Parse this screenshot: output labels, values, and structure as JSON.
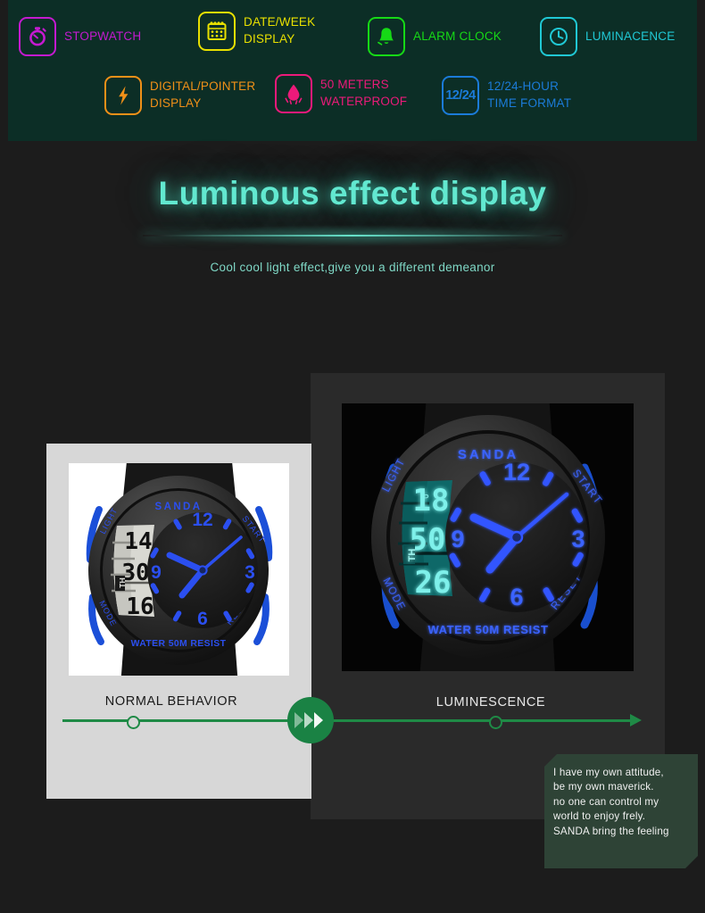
{
  "features": [
    {
      "id": "stopwatch",
      "icon": "stopwatch-icon",
      "label": "STOPWATCH",
      "color": "#c41ad0"
    },
    {
      "id": "date-week",
      "icon": "calendar-icon",
      "label": "DATE/WEEK\nDISPLAY",
      "color": "#e8e000"
    },
    {
      "id": "alarm-clock",
      "icon": "bell-icon",
      "label": "ALARM CLOCK",
      "color": "#16d916"
    },
    {
      "id": "luminacence",
      "icon": "clock-icon",
      "label": "LUMINACENCE",
      "color": "#20c8d4"
    },
    {
      "id": "digital-pointer",
      "icon": "lightning-icon",
      "label": "DIGITAL/POINTER\nDISPLAY",
      "color": "#f09018"
    },
    {
      "id": "waterproof",
      "icon": "water-drop-icon",
      "label": "50 METERS\nWATERPROOF",
      "color": "#ec1a7a"
    },
    {
      "id": "time-format",
      "icon": "twelve-twentyfour-icon",
      "label": "12/24-HOUR\nTIME FORMAT",
      "color": "#1b7bd8",
      "icon_text": "12/24"
    }
  ],
  "hero": {
    "title": "Luminous effect display",
    "subtitle": "Cool cool light effect,give you a different demeanor",
    "glow_color": "#62e8d0"
  },
  "comparison": {
    "normal": {
      "caption": "NORMAL BEHAVIOR",
      "watch": {
        "brand": "SANDA",
        "start_label": "START",
        "reset_label": "RESET",
        "light_label": "LIGHT",
        "mode_label": "MODE",
        "water_text": "WATER 50M RESIST",
        "lcd_top": "14",
        "lcd_mid": "30",
        "lcd_bottom": "16",
        "lcd_day": "TH",
        "hour_12": "12",
        "hour_3": "3",
        "hour_6": "6",
        "hour_9": "9",
        "accent_color": "#2b4ff0"
      }
    },
    "luminescence": {
      "caption": "LUMINESCENCE",
      "watch": {
        "brand": "SANDA",
        "start_label": "START",
        "reset_label": "RESET",
        "light_label": "LIGHT",
        "mode_label": "MODE",
        "water_text": "WATER 50M RESIST",
        "lcd_pm": "P",
        "lcd_top": "18",
        "lcd_mid": "50",
        "lcd_bottom": "26",
        "lcd_day": "TH",
        "hour_12": "12",
        "hour_3": "3",
        "hour_6": "6",
        "hour_9": "9",
        "accent_color": "#3355ff",
        "lcd_glow_color": "#6fe8e0"
      }
    },
    "timeline_color": "#1f8a46"
  },
  "quote": {
    "lines": "I have my own attitude,\nbe my own maverick.\nno one can control my\nworld to enjoy frely.\nSANDA bring the feeling",
    "bg_color": "#2e4336"
  }
}
